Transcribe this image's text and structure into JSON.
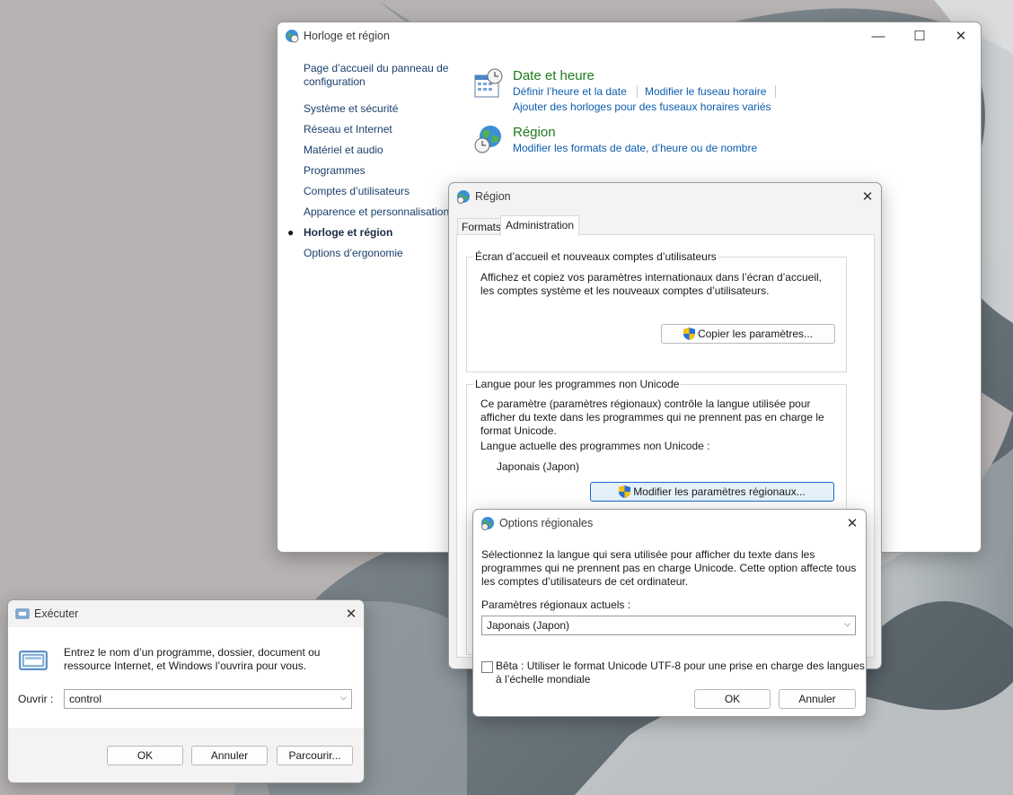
{
  "control_panel": {
    "title": "Horloge et région",
    "sidebar": {
      "home": "Page d’accueil du panneau de configuration",
      "items": [
        "Système et sécurité",
        "Réseau et Internet",
        "Matériel et audio",
        "Programmes",
        "Comptes d’utilisateurs",
        "Apparence et personnalisation",
        "Horloge et région",
        "Options d’ergonomie"
      ],
      "current": "Horloge et région"
    },
    "categories": {
      "datetime": {
        "title": "Date et heure",
        "link1": "Définir l’heure et la date",
        "link2": "Modifier le fuseau horaire",
        "link3": "Ajouter des horloges pour des fuseaux horaires variés"
      },
      "region": {
        "title": "Région",
        "link1": "Modifier les formats de date, d’heure ou de nombre"
      }
    }
  },
  "region_dialog": {
    "title": "Région",
    "tabs": [
      "Formats",
      "Administration"
    ],
    "active_tab": "Administration",
    "welcome_group": {
      "legend": "Écran d’accueil et nouveaux comptes d’utilisateurs",
      "desc_line1": "Affichez et copiez vos paramètres internationaux dans l’écran d’accueil,",
      "desc_line2": "les comptes système et les nouveaux comptes d’utilisateurs.",
      "button": "Copier les paramètres..."
    },
    "unicode_group": {
      "legend": "Langue pour les programmes non Unicode",
      "desc_line1": "Ce paramètre (paramètres régionaux) contrôle la langue utilisée pour",
      "desc_line2": "afficher du texte dans les programmes qui ne prennent pas en charge le",
      "desc_line3": "format Unicode.",
      "current_label": "Langue actuelle des programmes non Unicode :",
      "current_value": "Japonais (Japon)",
      "button": "Modifier les paramètres régionaux..."
    }
  },
  "regional_options": {
    "title": "Options régionales",
    "desc_line1": "Sélectionnez la langue qui sera utilisée pour afficher du texte dans les",
    "desc_line2": "programmes qui ne prennent pas en charge Unicode. Cette option affecte tous",
    "desc_line3": "les comptes d’utilisateurs de cet ordinateur.",
    "current_label": "Paramètres régionaux actuels :",
    "current_value": "Japonais (Japon)",
    "beta_line1": "Bêta : Utiliser le format Unicode UTF-8 pour une prise en charge des langues",
    "beta_line2": "à l’échelle mondiale",
    "beta_checked": false,
    "ok": "OK",
    "cancel": "Annuler"
  },
  "run_dialog": {
    "title": "Exécuter",
    "desc_line1": "Entrez le nom d’un programme, dossier, document ou",
    "desc_line2": "ressource Internet, et Windows l’ouvrira pour vous.",
    "open_label": "Ouvrir :",
    "open_value": "control",
    "ok": "OK",
    "cancel": "Annuler",
    "browse": "Parcourir..."
  },
  "colors": {
    "link": "#0b5cad",
    "category_title": "#1f7a1f",
    "accent": "#1b6ac9"
  }
}
